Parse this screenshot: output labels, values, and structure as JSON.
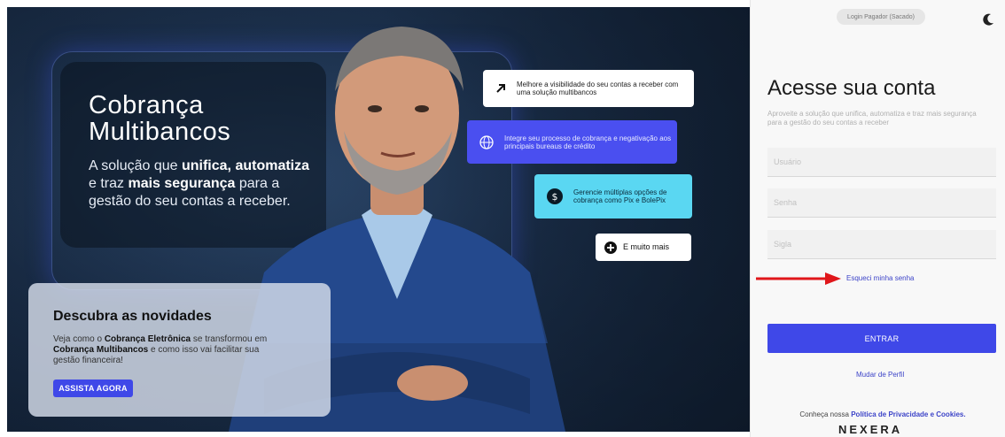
{
  "hero": {
    "title": "Cobrança Multibancos",
    "subtitle_parts": [
      "A solução que ",
      "unifica,",
      " ",
      "automatiza",
      " e traz ",
      "mais segurança",
      " para a gestão do seu contas a receber."
    ]
  },
  "features": [
    {
      "icon": "arrow-up-right-icon",
      "text": "Melhore a visibilidade do seu contas a receber com uma solução multibancos"
    },
    {
      "icon": "globe-icon",
      "text": "Integre seu processo de cobrança e negativação aos principais bureaus de crédito"
    },
    {
      "icon": "dollar-icon",
      "text": "Gerencie múltiplas opções de cobrança como Pix e BolePix"
    },
    {
      "icon": "plus-icon",
      "text": "E muito mais"
    }
  ],
  "news": {
    "title": "Descubra as novidades",
    "text_parts": [
      "Veja como o ",
      "Cobrança Eletrônica",
      " se transformou em ",
      "Cobrança Multibancos",
      " e como isso vai facilitar sua gestão financeira!"
    ],
    "button": "ASSISTA AGORA"
  },
  "panel": {
    "pill": "Login Pagador (Sacado)",
    "title": "Acesse sua conta",
    "subtitle": "Aproveite a solução que unifica, automatiza e traz mais segurança para a gestão do seu contas a receber",
    "fields": {
      "user": "Usuário",
      "password": "Senha",
      "code": "Sigla"
    },
    "forgot": "Esqueci minha senha",
    "enter": "ENTRAR",
    "change_profile": "Mudar de Perfil",
    "privacy_prefix": "Conheça nossa ",
    "privacy_link": "Política de Privacidade e Cookies.",
    "logo": "NEXERA"
  },
  "colors": {
    "accent": "#3f48e8",
    "cyan": "#5ad7f2",
    "annotation": "#e0161a"
  }
}
